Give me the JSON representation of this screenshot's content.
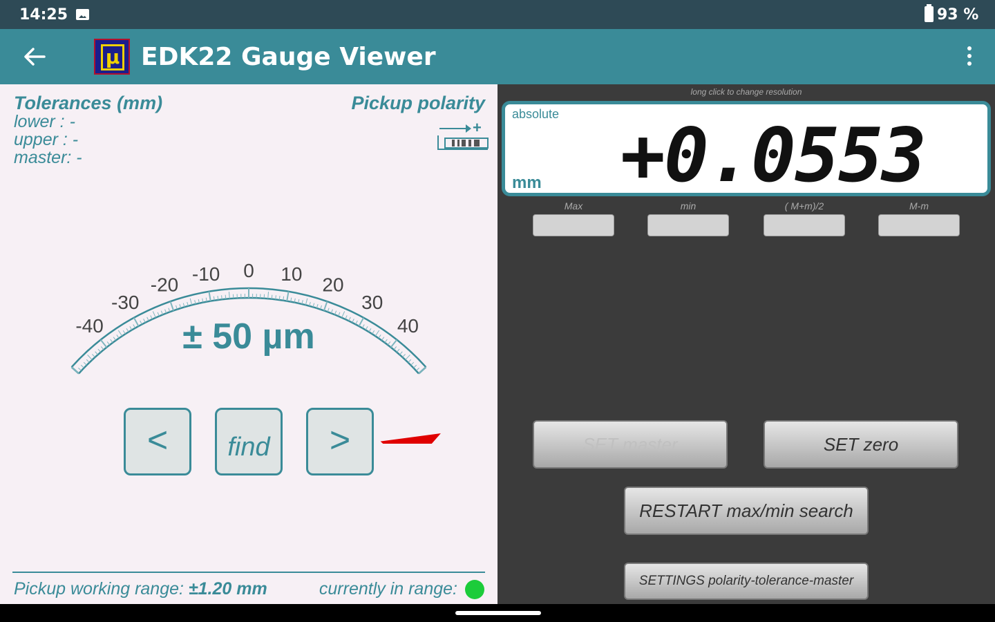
{
  "status_bar": {
    "time": "14:25",
    "battery": "93 %"
  },
  "app_bar": {
    "title": "EDK22 Gauge Viewer",
    "logo_glyph": "µ",
    "back_icon": "arrow-left-icon",
    "menu_icon": "more-vert-icon"
  },
  "left": {
    "tolerances_title": "Tolerances (mm)",
    "lower": "lower :   -",
    "upper": "upper :   -",
    "master": "master: -",
    "pickup_polarity": "Pickup polarity",
    "polarity_sign": "+",
    "gauge": {
      "range_label": "± 50 µm",
      "ticks": [
        "-40",
        "-30",
        "-20",
        "-10",
        "0",
        "10",
        "20",
        "30",
        "40"
      ],
      "min": -50,
      "max": 50,
      "needle_value": 55.3,
      "needle_color": "#e00000"
    },
    "buttons": {
      "prev": "<",
      "find": "find",
      "next": ">"
    },
    "working_range_prefix": "Pickup working range: ",
    "working_range_value": "±1.20 mm",
    "in_range_label": "currently in range:",
    "in_range_color": "#1ccc3a"
  },
  "right": {
    "long_click_hint": "long click to change resolution",
    "display": {
      "mode": "absolute",
      "unit": "mm",
      "value": "+0.0553"
    },
    "stats": [
      {
        "label": "Max",
        "value": ""
      },
      {
        "label": "min",
        "value": ""
      },
      {
        "label": "( M+m)/2",
        "value": ""
      },
      {
        "label": "M-m",
        "value": ""
      }
    ],
    "buttons": {
      "set_master": "SET master",
      "set_zero": "SET zero",
      "restart": "RESTART max/min search",
      "settings": "SETTINGS polarity-tolerance-master"
    }
  },
  "colors": {
    "accent": "#3a8b98",
    "status_bar": "#2e4a56",
    "right_bg": "#3b3b3b",
    "left_bg": "#f7f0f5"
  }
}
